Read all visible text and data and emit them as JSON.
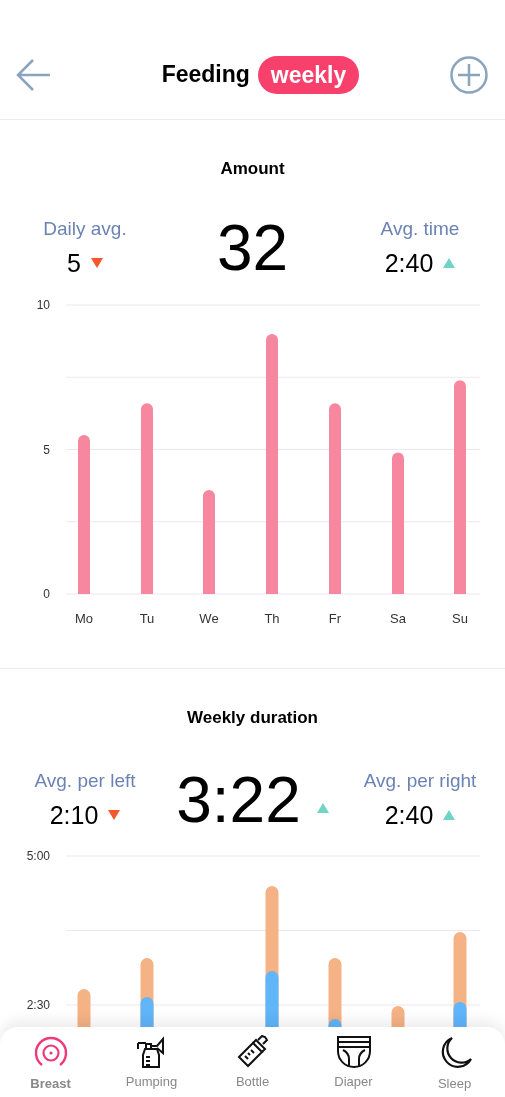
{
  "header": {
    "title": "Feeding",
    "period": "weekly"
  },
  "sections": [
    {
      "title": "Amount",
      "left": {
        "label": "Daily avg.",
        "value": "5",
        "rising": false
      },
      "main": {
        "value": "32"
      },
      "right": {
        "label": "Avg. time",
        "value": "2:40",
        "rising": true
      },
      "chart_data": {
        "type": "bar",
        "categories": [
          "Mo",
          "Tu",
          "We",
          "Th",
          "Fr",
          "Sa",
          "Su"
        ],
        "series": [
          {
            "color": "#f7869f",
            "values": [
              5.5,
              6.6,
              3.6,
              9.0,
              6.6,
              4.9,
              7.4
            ]
          }
        ],
        "ylim": [
          0,
          10
        ],
        "yticks": [
          {
            "value": 0,
            "label": "0"
          },
          {
            "value": 5,
            "label": "5"
          },
          {
            "value": 10,
            "label": "10"
          }
        ]
      }
    },
    {
      "title": "Weekly duration",
      "left": {
        "label": "Avg. per left",
        "value": "2:10",
        "rising": false
      },
      "main": {
        "value": "3:22",
        "rising": true
      },
      "right": {
        "label": "Avg. per right",
        "value": "2:40",
        "rising": true
      },
      "axis_labels": [
        "5:00",
        "2:30"
      ]
    }
  ],
  "nav": [
    {
      "label": "Breast",
      "selected": true,
      "kind": "breast"
    },
    {
      "label": "Pumping",
      "selected": false,
      "kind": "pump"
    },
    {
      "label": "Bottle",
      "selected": false,
      "kind": "bottle"
    },
    {
      "label": "Diaper",
      "selected": false,
      "kind": "diaper"
    },
    {
      "label": "Sleep",
      "selected": false,
      "kind": "sleep"
    }
  ]
}
